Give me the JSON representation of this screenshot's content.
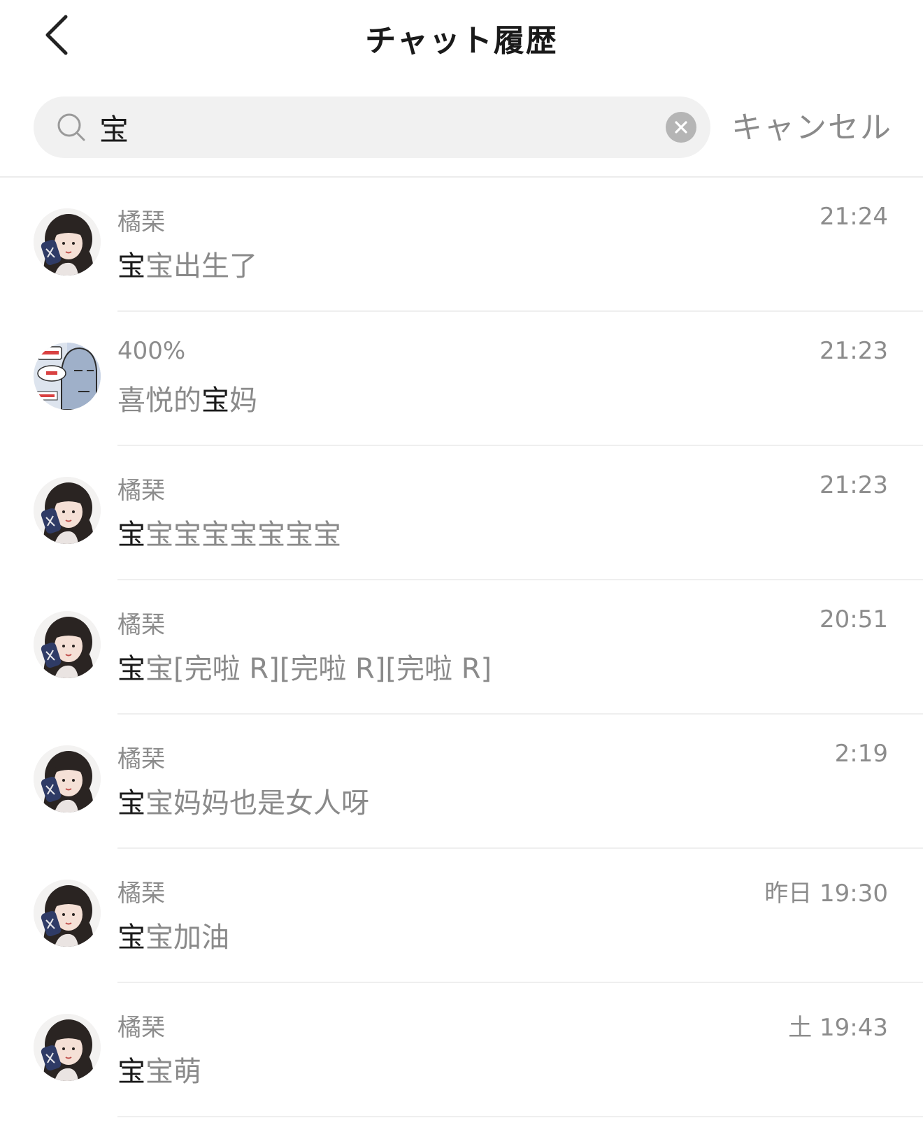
{
  "header": {
    "title": "チャット履歴",
    "back_icon": "chevron-left-icon"
  },
  "search": {
    "query": "宝",
    "placeholder": "",
    "clear_icon": "clear-circle-icon",
    "cancel_label": "キャンセル"
  },
  "results": [
    {
      "sender": "橘琹",
      "time": "21:24",
      "avatar": "girl",
      "before": "",
      "highlight": "宝",
      "after": "宝出生了"
    },
    {
      "sender": "400%",
      "time": "21:23",
      "avatar": "comic",
      "before": "喜悦的",
      "highlight": "宝",
      "after": "妈"
    },
    {
      "sender": "橘琹",
      "time": "21:23",
      "avatar": "girl",
      "before": "",
      "highlight": "宝",
      "after": "宝宝宝宝宝宝宝"
    },
    {
      "sender": "橘琹",
      "time": "20:51",
      "avatar": "girl",
      "before": "",
      "highlight": "宝",
      "after": "宝[完啦 R][完啦 R][完啦 R]"
    },
    {
      "sender": "橘琹",
      "time": "2:19",
      "avatar": "girl",
      "before": "",
      "highlight": "宝",
      "after": "宝妈妈也是女人呀"
    },
    {
      "sender": "橘琹",
      "time": "昨日 19:30",
      "avatar": "girl",
      "before": "",
      "highlight": "宝",
      "after": "宝加油"
    },
    {
      "sender": "橘琹",
      "time": "土 19:43",
      "avatar": "girl",
      "before": "",
      "highlight": "宝",
      "after": "宝萌"
    }
  ],
  "colors": {
    "background": "#ffffff",
    "search_bg": "#f1f1f1",
    "secondary_text": "#8c8c8c",
    "highlight_text": "#1a1a1a",
    "divider": "#efefef"
  }
}
